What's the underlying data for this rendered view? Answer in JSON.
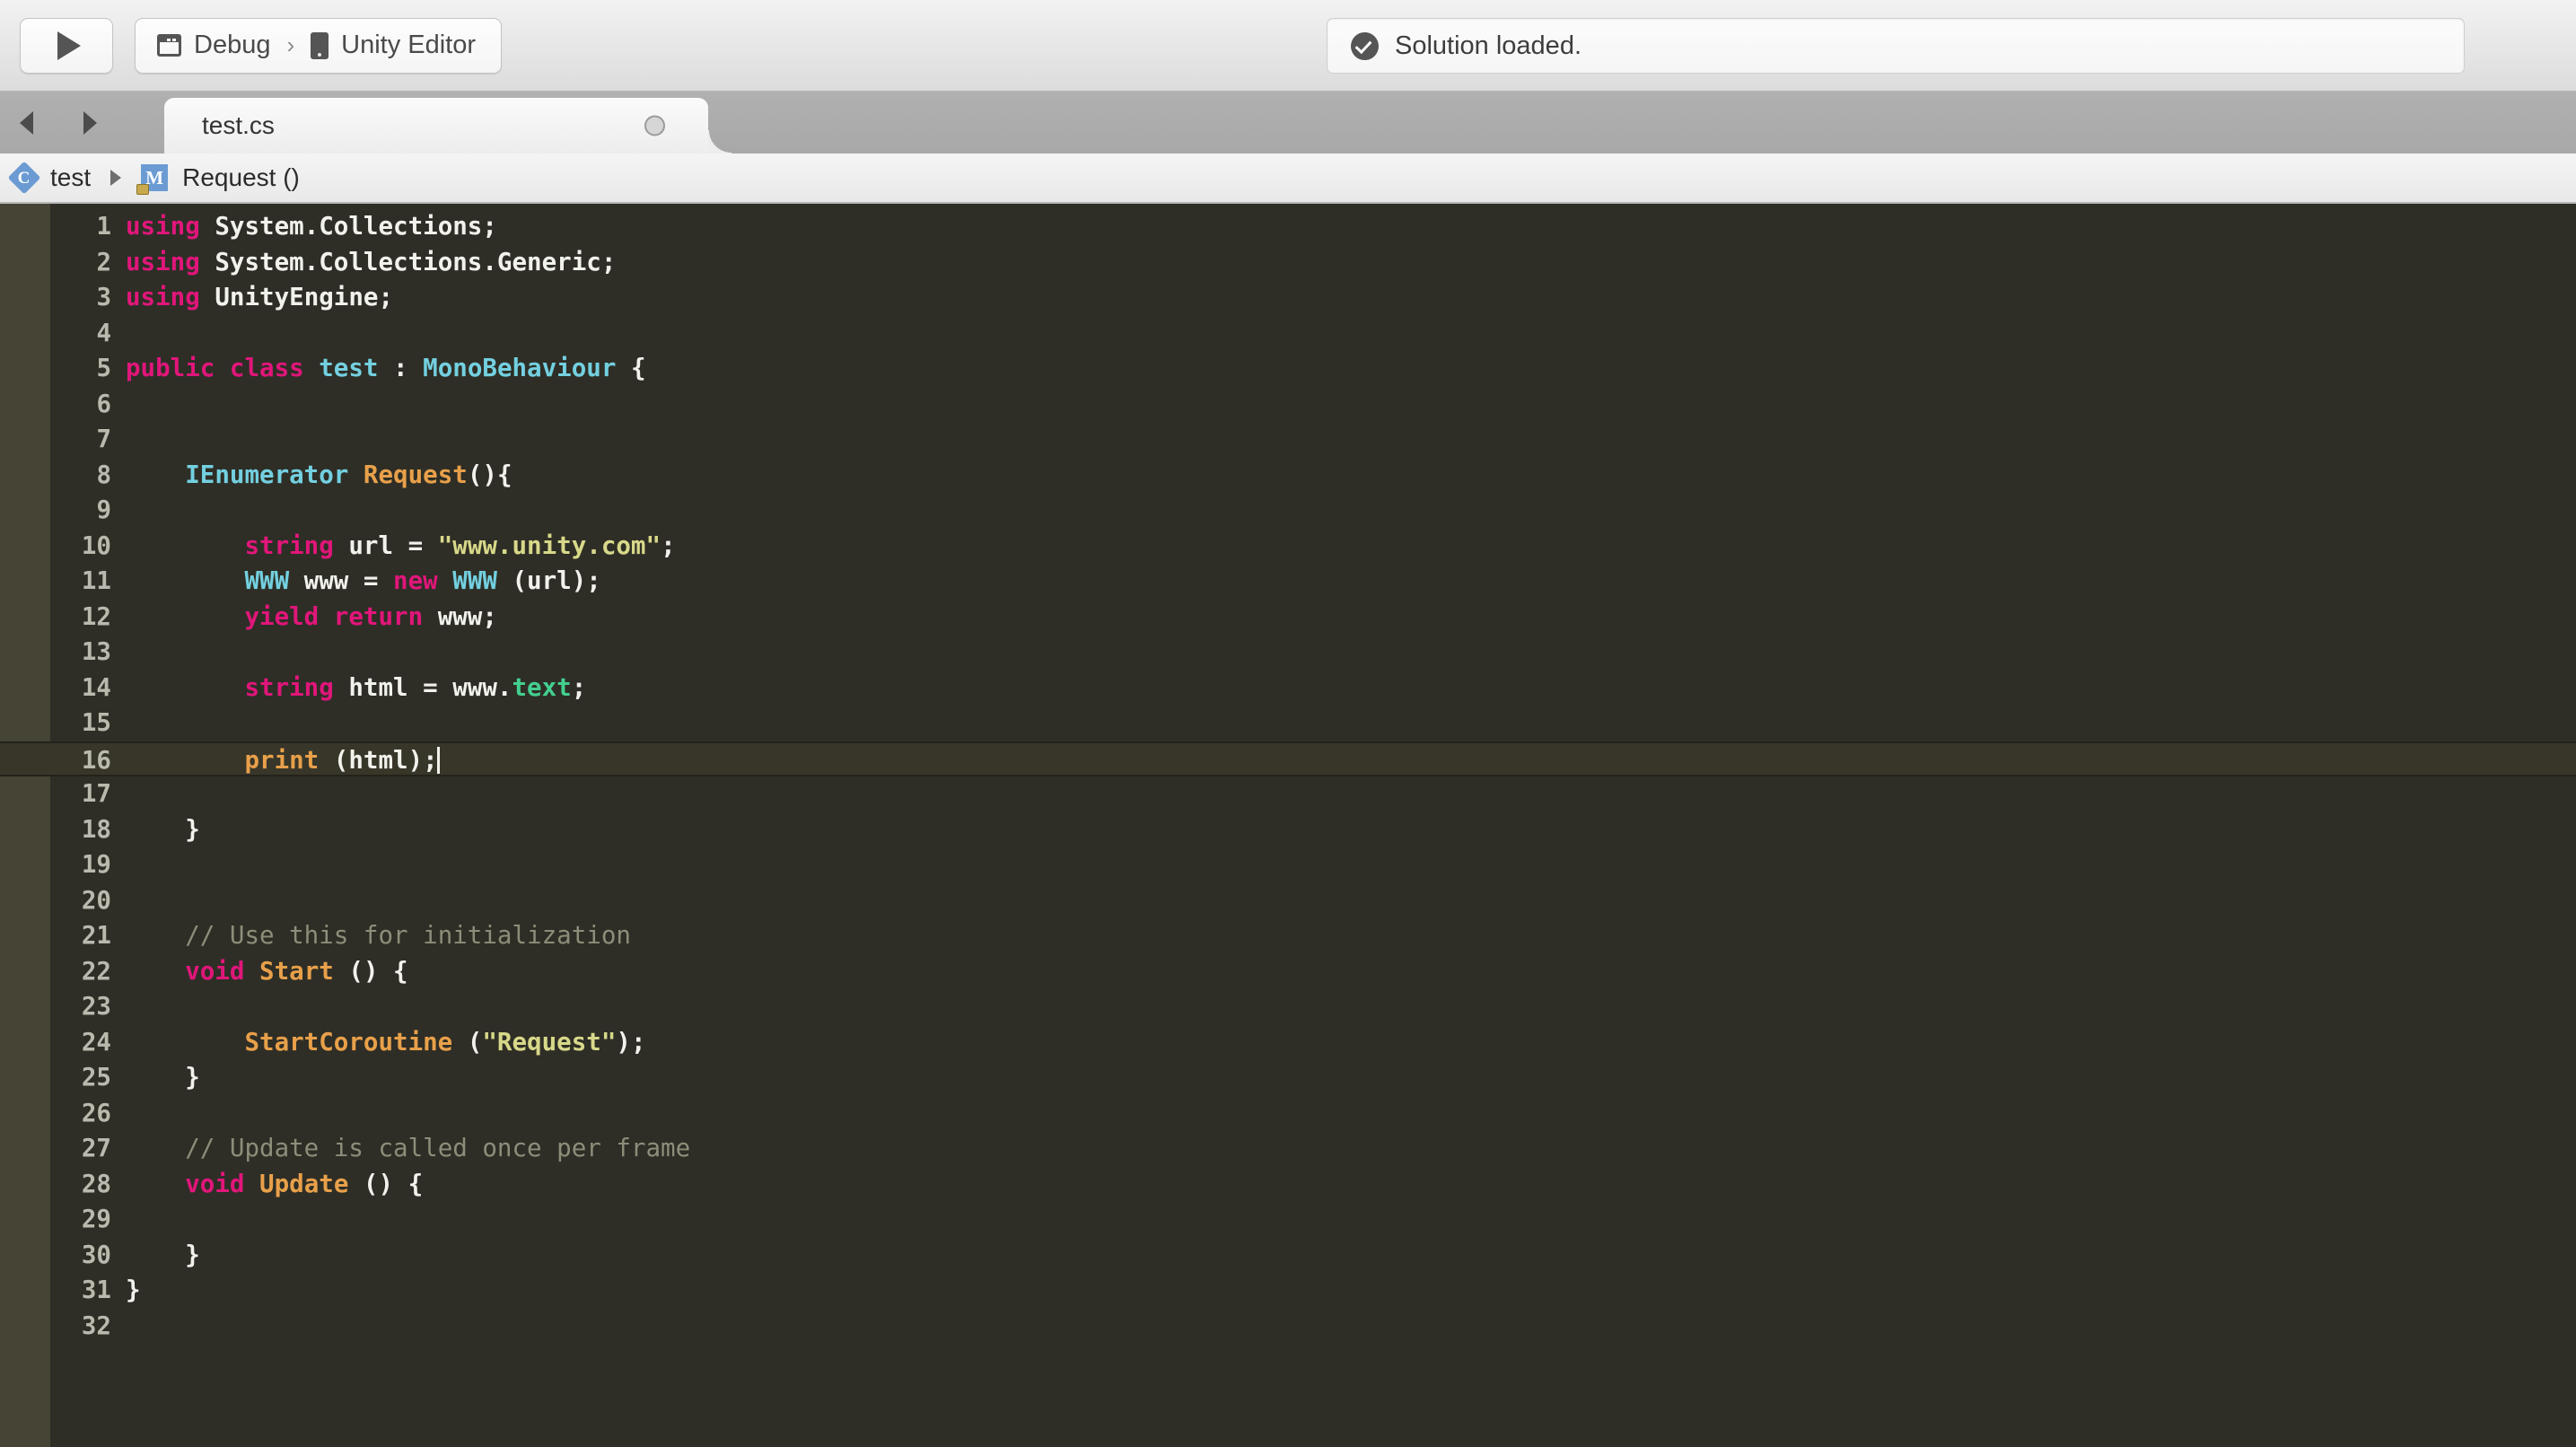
{
  "toolbar": {
    "run_icon": "play-triangle-icon",
    "configuration": {
      "icon": "window-icon",
      "label": "Debug"
    },
    "separator": "›",
    "target": {
      "icon": "device-icon",
      "label": "Unity Editor"
    },
    "status": {
      "icon": "check-circle-icon",
      "text": "Solution loaded."
    }
  },
  "tabstrip": {
    "back_icon": "arrow-left-icon",
    "forward_icon": "arrow-right-icon",
    "tabs": [
      {
        "label": "test.cs",
        "close_icon": "close-circle-icon",
        "active": true
      }
    ]
  },
  "breadcrumb": {
    "items": [
      {
        "icon": "class-diamond-icon",
        "icon_letter": "C",
        "label": "test"
      },
      {
        "icon": "method-square-icon",
        "icon_letter": "M",
        "label": "Request ()"
      }
    ],
    "separator": "▶"
  },
  "editor": {
    "language": "csharp",
    "current_line": 16,
    "caret_line": 16,
    "caret_column": 23,
    "colors": {
      "background": "#2e2e26",
      "fold_gutter": "#454435",
      "line_number": "#b9b9ad",
      "current_line_highlight": "#383629",
      "keyword": "#e0167a",
      "type": "#73d0e0",
      "function": "#e8a04a",
      "string": "#d8d88a",
      "comment": "#8d8d7a",
      "member": "#43cf8f",
      "plain": "#f2f2ec"
    },
    "lines": [
      {
        "n": "1",
        "tokens": [
          {
            "t": "using",
            "c": "kw"
          },
          {
            "t": " System.Collections;",
            "c": "pln"
          }
        ]
      },
      {
        "n": "2",
        "tokens": [
          {
            "t": "using",
            "c": "kw"
          },
          {
            "t": " System.Collections.Generic;",
            "c": "pln"
          }
        ]
      },
      {
        "n": "3",
        "tokens": [
          {
            "t": "using",
            "c": "kw"
          },
          {
            "t": " UnityEngine;",
            "c": "pln"
          }
        ]
      },
      {
        "n": "4",
        "tokens": []
      },
      {
        "n": "5",
        "tokens": [
          {
            "t": "public class",
            "c": "kw"
          },
          {
            "t": " ",
            "c": "pln"
          },
          {
            "t": "test",
            "c": "typ"
          },
          {
            "t": " : ",
            "c": "pln"
          },
          {
            "t": "MonoBehaviour",
            "c": "typ"
          },
          {
            "t": " {",
            "c": "pln"
          }
        ]
      },
      {
        "n": "6",
        "tokens": []
      },
      {
        "n": "7",
        "tokens": []
      },
      {
        "n": "8",
        "tokens": [
          {
            "t": "    ",
            "c": "pln"
          },
          {
            "t": "IEnumerator",
            "c": "typ"
          },
          {
            "t": " ",
            "c": "pln"
          },
          {
            "t": "Request",
            "c": "fn"
          },
          {
            "t": "(){",
            "c": "pln"
          }
        ]
      },
      {
        "n": "9",
        "tokens": []
      },
      {
        "n": "10",
        "tokens": [
          {
            "t": "        ",
            "c": "pln"
          },
          {
            "t": "string",
            "c": "kw"
          },
          {
            "t": " url = ",
            "c": "pln"
          },
          {
            "t": "\"www.unity.com\"",
            "c": "str"
          },
          {
            "t": ";",
            "c": "pln"
          }
        ]
      },
      {
        "n": "11",
        "tokens": [
          {
            "t": "        ",
            "c": "pln"
          },
          {
            "t": "WWW",
            "c": "typ"
          },
          {
            "t": " www = ",
            "c": "pln"
          },
          {
            "t": "new",
            "c": "kw"
          },
          {
            "t": " ",
            "c": "pln"
          },
          {
            "t": "WWW",
            "c": "typ"
          },
          {
            "t": " (url);",
            "c": "pln"
          }
        ]
      },
      {
        "n": "12",
        "tokens": [
          {
            "t": "        ",
            "c": "pln"
          },
          {
            "t": "yield return",
            "c": "kw"
          },
          {
            "t": " www;",
            "c": "pln"
          }
        ]
      },
      {
        "n": "13",
        "tokens": []
      },
      {
        "n": "14",
        "tokens": [
          {
            "t": "        ",
            "c": "pln"
          },
          {
            "t": "string",
            "c": "kw"
          },
          {
            "t": " html = www.",
            "c": "pln"
          },
          {
            "t": "text",
            "c": "mem"
          },
          {
            "t": ";",
            "c": "pln"
          }
        ]
      },
      {
        "n": "15",
        "tokens": []
      },
      {
        "n": "16",
        "tokens": [
          {
            "t": "        ",
            "c": "pln"
          },
          {
            "t": "print",
            "c": "fn"
          },
          {
            "t": " (html);",
            "c": "pln"
          }
        ],
        "current": true,
        "caret": true
      },
      {
        "n": "17",
        "tokens": []
      },
      {
        "n": "18",
        "tokens": [
          {
            "t": "    }",
            "c": "pln"
          }
        ]
      },
      {
        "n": "19",
        "tokens": []
      },
      {
        "n": "20",
        "tokens": []
      },
      {
        "n": "21",
        "tokens": [
          {
            "t": "    ",
            "c": "pln"
          },
          {
            "t": "// Use this for initialization",
            "c": "cmt"
          }
        ]
      },
      {
        "n": "22",
        "tokens": [
          {
            "t": "    ",
            "c": "pln"
          },
          {
            "t": "void",
            "c": "kw"
          },
          {
            "t": " ",
            "c": "pln"
          },
          {
            "t": "Start",
            "c": "fn"
          },
          {
            "t": " () {",
            "c": "pln"
          }
        ]
      },
      {
        "n": "23",
        "tokens": []
      },
      {
        "n": "24",
        "tokens": [
          {
            "t": "        ",
            "c": "pln"
          },
          {
            "t": "StartCoroutine",
            "c": "fn"
          },
          {
            "t": " (",
            "c": "pln"
          },
          {
            "t": "\"Request\"",
            "c": "str"
          },
          {
            "t": ");",
            "c": "pln"
          }
        ]
      },
      {
        "n": "25",
        "tokens": [
          {
            "t": "    }",
            "c": "pln"
          }
        ]
      },
      {
        "n": "26",
        "tokens": []
      },
      {
        "n": "27",
        "tokens": [
          {
            "t": "    ",
            "c": "pln"
          },
          {
            "t": "// Update is called once per frame",
            "c": "cmt"
          }
        ]
      },
      {
        "n": "28",
        "tokens": [
          {
            "t": "    ",
            "c": "pln"
          },
          {
            "t": "void",
            "c": "kw"
          },
          {
            "t": " ",
            "c": "pln"
          },
          {
            "t": "Update",
            "c": "fn"
          },
          {
            "t": " () {",
            "c": "pln"
          }
        ]
      },
      {
        "n": "29",
        "tokens": []
      },
      {
        "n": "30",
        "tokens": [
          {
            "t": "    }",
            "c": "pln"
          }
        ]
      },
      {
        "n": "31",
        "tokens": [
          {
            "t": "}",
            "c": "pln"
          }
        ]
      },
      {
        "n": "32",
        "tokens": []
      }
    ]
  }
}
